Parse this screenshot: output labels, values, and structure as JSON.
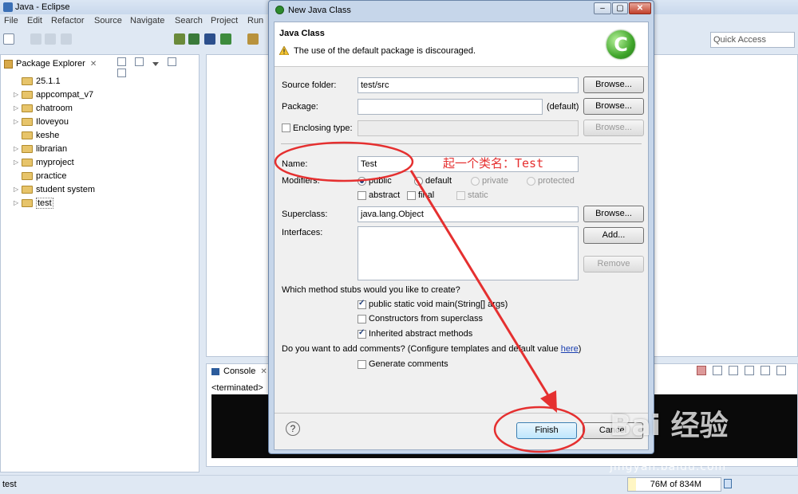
{
  "window": {
    "title": "Java - Eclipse"
  },
  "menu": [
    "File",
    "Edit",
    "Refactor",
    "Source",
    "Navigate",
    "Search",
    "Project",
    "Run"
  ],
  "quick_access": {
    "placeholder": "Quick Access"
  },
  "package_explorer": {
    "title": "Package Explorer",
    "items": [
      {
        "label": "25.1.1",
        "expandable": false
      },
      {
        "label": "appcompat_v7",
        "expandable": true
      },
      {
        "label": "chatroom",
        "expandable": true
      },
      {
        "label": "Iloveyou",
        "expandable": true
      },
      {
        "label": "keshe",
        "expandable": false
      },
      {
        "label": "librarian",
        "expandable": true
      },
      {
        "label": "myproject",
        "expandable": true
      },
      {
        "label": "practice",
        "expandable": false
      },
      {
        "label": "student system",
        "expandable": true
      },
      {
        "label": "test",
        "expandable": true,
        "selected": true
      }
    ]
  },
  "console": {
    "title": "Console",
    "status": "<terminated>"
  },
  "status_bar": {
    "left": "test",
    "heap": "76M of 834M",
    "heap_used_fraction": 0.09
  },
  "dialog": {
    "title": "New Java Class",
    "header": {
      "title": "Java Class",
      "warning": "The use of the default package is discouraged.",
      "logo_glyph": "C"
    },
    "source_folder": {
      "label": "Source folder:",
      "value": "test/src",
      "button": "Browse..."
    },
    "package": {
      "label": "Package:",
      "value": "",
      "default_label": "(default)",
      "button": "Browse..."
    },
    "enclosing_type": {
      "label": "Enclosing type:",
      "checked": false,
      "value": "",
      "button": "Browse..."
    },
    "name": {
      "label": "Name:",
      "value": "Test"
    },
    "modifiers": {
      "label": "Modifiers:",
      "access": [
        {
          "label": "public",
          "checked": true,
          "enabled": true
        },
        {
          "label": "default",
          "checked": false,
          "enabled": true
        },
        {
          "label": "private",
          "checked": false,
          "enabled": false
        },
        {
          "label": "protected",
          "checked": false,
          "enabled": false
        }
      ],
      "flags": [
        {
          "label": "abstract",
          "checked": false,
          "enabled": true
        },
        {
          "label": "final",
          "checked": false,
          "enabled": true
        },
        {
          "label": "static",
          "checked": false,
          "enabled": false
        }
      ]
    },
    "superclass": {
      "label": "Superclass:",
      "value": "java.lang.Object",
      "button": "Browse..."
    },
    "interfaces": {
      "label": "Interfaces:",
      "add_button": "Add...",
      "remove_button": "Remove"
    },
    "stubs": {
      "question": "Which method stubs would you like to create?",
      "options": [
        {
          "label": "public static void main(String[] args)",
          "checked": true
        },
        {
          "label": "Constructors from superclass",
          "checked": false
        },
        {
          "label": "Inherited abstract methods",
          "checked": true
        }
      ]
    },
    "comments": {
      "question": "Do you want to add comments? (Configure templates and default value ",
      "link": "here",
      "close": ")",
      "option": {
        "label": "Generate comments",
        "checked": false
      }
    },
    "buttons": {
      "finish": "Finish",
      "cancel": "Cancel",
      "help": "?"
    }
  },
  "annotations": {
    "note": "起一个类名：Test",
    "color": "#e53030"
  },
  "watermark": {
    "logo": "Bai 经验",
    "url": "jingyan.baidu.com"
  }
}
